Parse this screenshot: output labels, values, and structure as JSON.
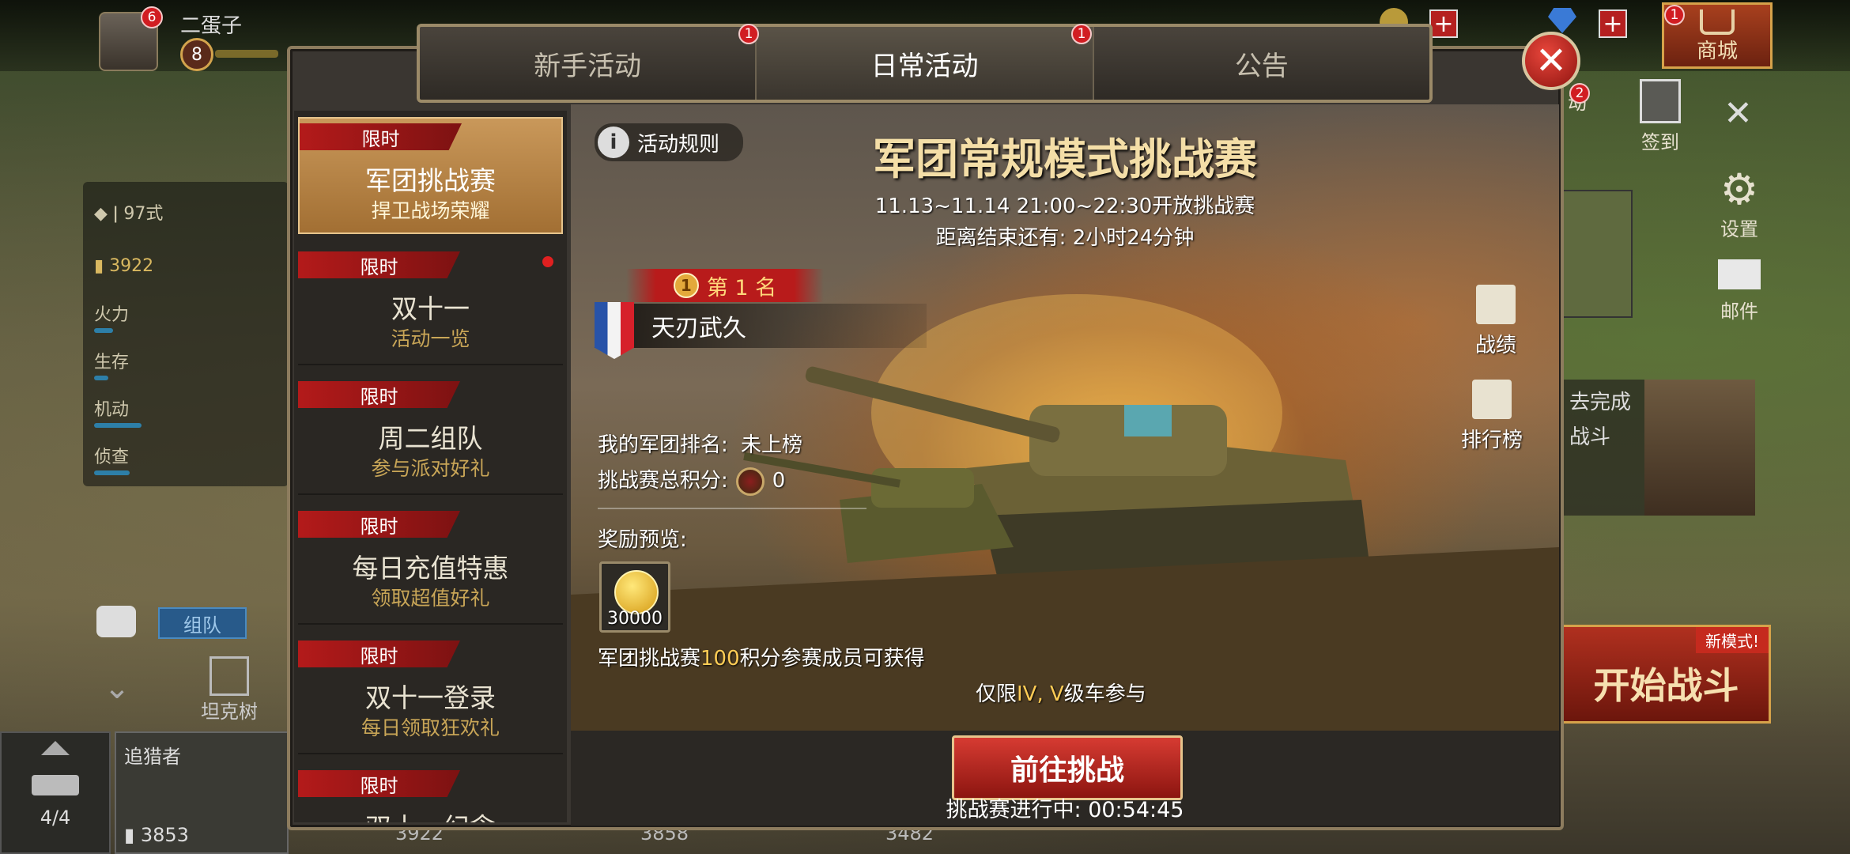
{
  "player": {
    "name": "二蛋子",
    "level": "8",
    "avatar_badge": "6"
  },
  "top_right": {
    "mall_label": "商城",
    "mall_badge": "1"
  },
  "background_left": {
    "tank_name": "97式",
    "power": "3922",
    "stats": [
      "火力",
      "生存",
      "机动",
      "侦查"
    ],
    "team_button": "组队",
    "tank_tree": "坦克树",
    "hunter_name": "追猎者",
    "hunter_power": "3853",
    "garage_count": "4/4",
    "bottom_values": [
      "3922",
      "3858",
      "3482"
    ]
  },
  "background_right": {
    "checkin_label": "签到",
    "activity_partial": "动",
    "activity_badge": "2",
    "settings_label": "设置",
    "mail_label": "邮件",
    "task_partial1": "去完成",
    "task_partial2": "战斗",
    "new_mode": "新模式!",
    "start_battle": "开始战斗"
  },
  "tabs": [
    {
      "label": "新手活动",
      "badge": "1"
    },
    {
      "label": "日常活动",
      "badge": "1"
    },
    {
      "label": "公告",
      "badge": ""
    }
  ],
  "side_items": [
    {
      "tag": "限时",
      "title": "军团挑战赛",
      "subtitle": "捍卫战场荣耀"
    },
    {
      "tag": "限时",
      "title": "双十一",
      "subtitle": "活动一览"
    },
    {
      "tag": "限时",
      "title": "周二组队",
      "subtitle": "参与派对好礼"
    },
    {
      "tag": "限时",
      "title": "每日充值特惠",
      "subtitle": "领取超值好礼"
    },
    {
      "tag": "限时",
      "title": "双十一登录",
      "subtitle": "每日领取狂欢礼"
    },
    {
      "tag": "限时",
      "title": "双十一纪念",
      "subtitle": ""
    }
  ],
  "event": {
    "rules_label": "活动规则",
    "title": "军团常规模式挑战赛",
    "schedule": "11.13~11.14 21:00~22:30开放挑战赛",
    "countdown": "距离结束还有: 2小时24分钟",
    "rank_medal": "1",
    "rank_label": "第 1 名",
    "top_legion": "天刃武久",
    "my_rank_label": "我的军团排名:",
    "my_rank_value": "未上榜",
    "score_label": "挑战赛总积分:",
    "score_value": "0",
    "reward_label": "奖励预览:",
    "reward_amount": "30000",
    "reward_note_pre": "军团挑战赛",
    "reward_note_num": "100",
    "reward_note_post": "积分参赛成员可获得",
    "limit_pre": "仅限",
    "limit_tiers": "IV, V",
    "limit_post": "级车参与",
    "record_label": "战绩",
    "leaderboard_label": "排行榜",
    "go_button": "前往挑战",
    "progress": "挑战赛进行中: 00:54:45"
  }
}
